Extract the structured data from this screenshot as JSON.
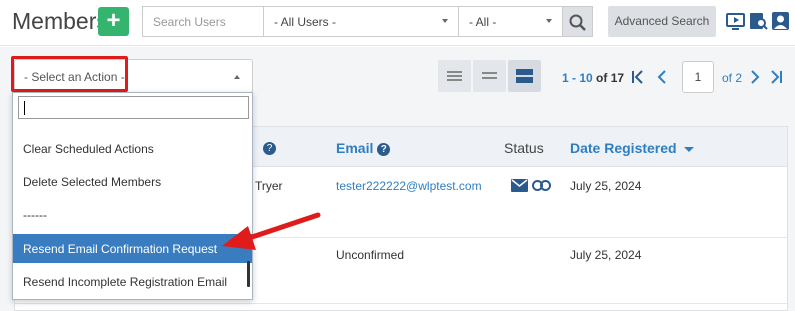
{
  "header": {
    "title": "Members",
    "add_button": "+",
    "search_placeholder": "Search Users",
    "user_filter": "- All Users -",
    "status_filter": "- All -",
    "advanced_search": "Advanced Search"
  },
  "toolbar": {
    "action_select": "- Select an Action -",
    "pager_range": "1 - 10",
    "pager_of": "of",
    "pager_total": "17",
    "page_value": "1",
    "page_of": "of 2"
  },
  "table": {
    "columns": [
      "Email",
      "Status",
      "Date Registered"
    ],
    "rows": [
      {
        "name_fragment": "Tryer",
        "email": "tester222222@wlptest.com",
        "status": "",
        "date": "July 25, 2024"
      },
      {
        "name_fragment": "",
        "email": "Unconfirmed",
        "status": "",
        "date": "July 25, 2024"
      }
    ]
  },
  "dropdown": {
    "items": [
      "Clear Scheduled Actions",
      "Delete Selected Members",
      "------",
      "Resend Email Confirmation Request",
      "Resend Incomplete Registration Email"
    ],
    "highlighted_index": 3
  },
  "colors": {
    "brand_green": "#34b46e",
    "link_blue": "#2e7fc2",
    "highlight_blue": "#3a7cc0",
    "annotation_red": "#e01b1b"
  }
}
